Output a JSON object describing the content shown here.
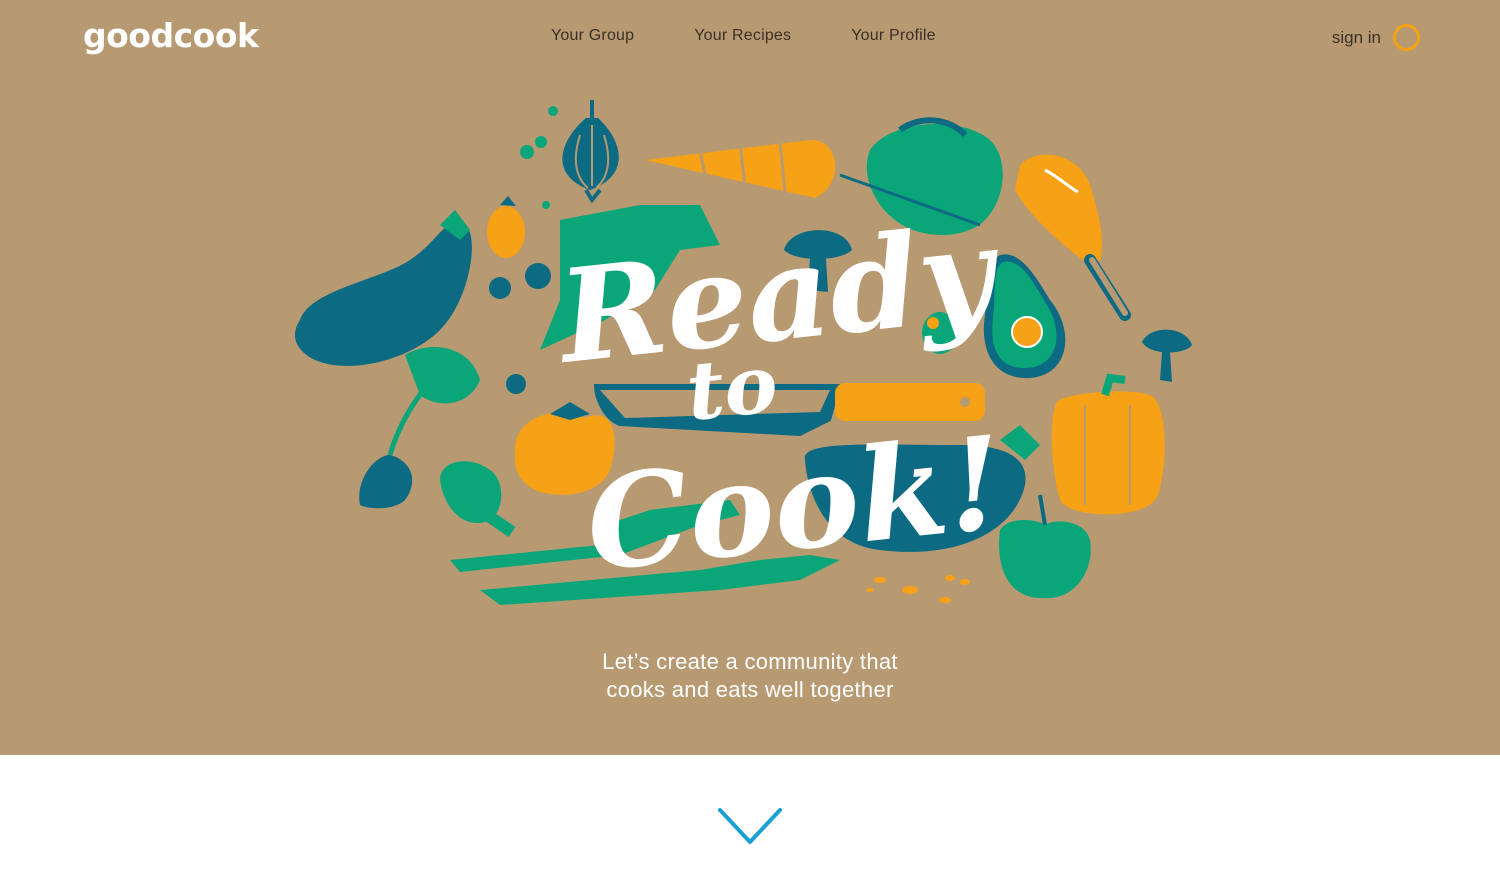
{
  "header": {
    "logo": "goodcook",
    "nav": [
      {
        "label": "Your Group"
      },
      {
        "label": "Your Recipes"
      },
      {
        "label": "Your Profile"
      }
    ],
    "signin_label": "sign in"
  },
  "hero": {
    "headline": [
      "Ready",
      "to",
      "Cook!"
    ],
    "tagline_lines": [
      "Let’s create a community that",
      "cooks and eats well together"
    ]
  },
  "colors": {
    "hero_bg": "#b79a72",
    "teal": "#0c6a82",
    "green": "#0ba57a",
    "orange": "#f7a116",
    "accent_blue": "#1a9fd6"
  },
  "icons": {
    "signin": "ring-icon",
    "scroll": "chevron-down-icon"
  }
}
